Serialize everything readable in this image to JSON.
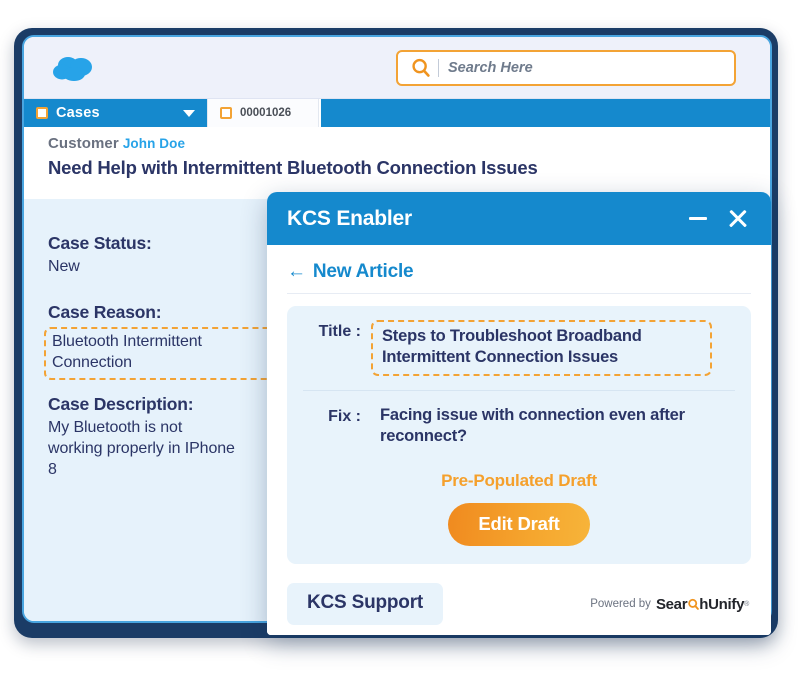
{
  "app": {
    "logo_icon": "salesforce-cloud-icon",
    "search": {
      "placeholder": "Search Here",
      "value": "",
      "icon": "search-icon"
    },
    "tabs": [
      {
        "label": "Cases",
        "icon": "case-square-icon",
        "caret": "chevron-down-icon",
        "active": true
      },
      {
        "label": "00001026",
        "icon": "case-square-icon",
        "active": false
      }
    ]
  },
  "record": {
    "customer_label": "Customer",
    "customer_name": "John Doe",
    "title": "Need Help with Intermittent Bluetooth Connection Issues",
    "fields": [
      {
        "label": "Case Status:",
        "value": "New",
        "highlighted": false
      },
      {
        "label": "Case Reason:",
        "value": "Bluetooth Intermittent Connection",
        "highlighted": true
      },
      {
        "label": "Case Description:",
        "value": "My Bluetooth is not working properly in IPhone 8",
        "highlighted": false
      }
    ]
  },
  "modal": {
    "title": "KCS Enabler",
    "minimize_icon": "minimize-icon",
    "close_icon": "close-icon",
    "back_link": "New Article",
    "back_arrow": "←",
    "article": {
      "title_label": "Title :",
      "title_value": "Steps to Troubleshoot Broadband Intermittent Connection Issues",
      "fix_label": "Fix :",
      "fix_value": "Facing issue with connection even after reconnect?",
      "prepopulated_note": "Pre-Populated Draft",
      "edit_button": "Edit Draft"
    },
    "footer": {
      "support_button": "KCS Support",
      "powered_by": "Powered by",
      "brand_part1": "Sear",
      "brand_part2": "hUnify",
      "brand_icon": "magnifier-c-icon",
      "trademark": "®"
    }
  },
  "colors": {
    "frame_navy": "#1b3c66",
    "brand_blue": "#1589cd",
    "accent_orange": "#f3a335",
    "panel_blue": "#e6f2fb",
    "text_navy": "#2b3566",
    "link_blue": "#27a3e8"
  }
}
